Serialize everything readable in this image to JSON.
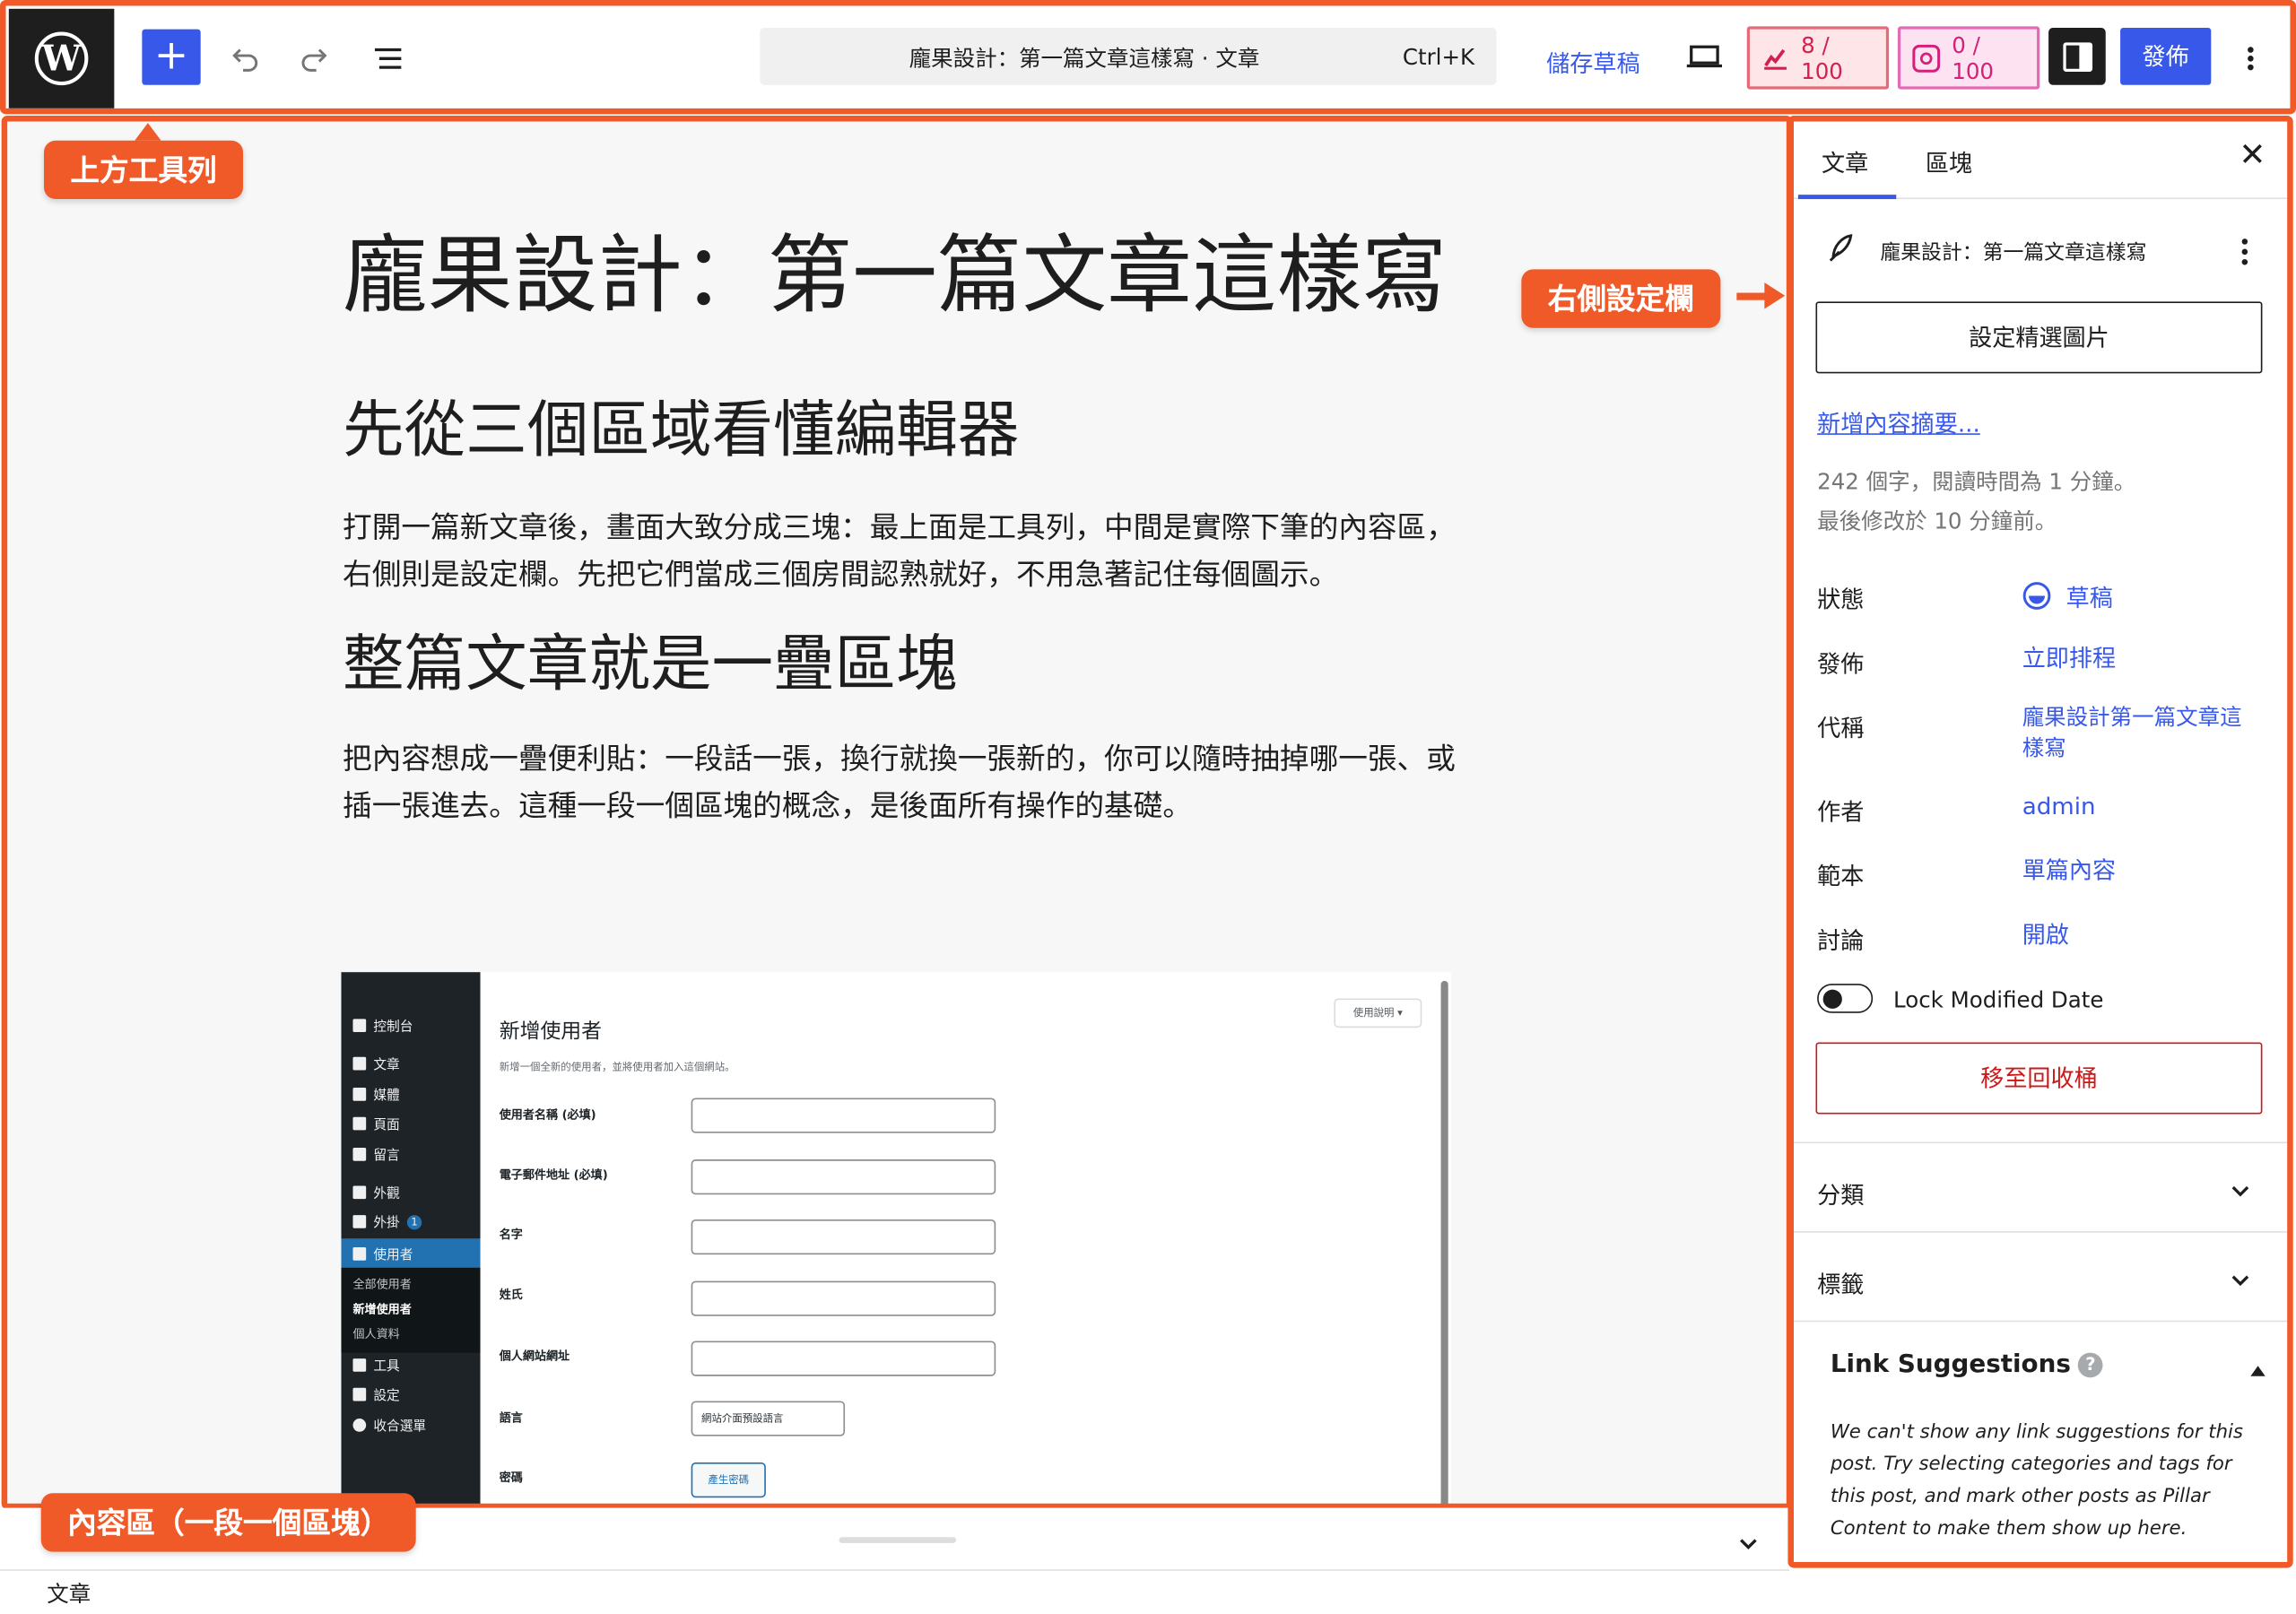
{
  "topbar": {
    "doc_title": "龐果設計：第一篇文章這樣寫 · 文章",
    "shortcut": "Ctrl+K",
    "save_draft": "儲存草稿",
    "counter1": "8 / 100",
    "counter2": "0 / 100",
    "publish": "發佈",
    "accent": "#3858e9"
  },
  "callouts": {
    "top_toolbar": "上方工具列",
    "right_sidebar": "右側設定欄",
    "content_area": "內容區（一段一個區塊）",
    "color": "#f05a28"
  },
  "content": {
    "title": "龐果設計：第一篇文章這樣寫",
    "h2_1": "先從三個區域看懂編輯器",
    "p1": "打開一篇新文章後，畫面大致分成三塊：最上面是工具列，中間是實際下筆的內容區，右側則是設定欄。先把它們當成三個房間認熟就好，不用急著記住每個圖示。",
    "h2_2": "整篇文章就是一疊區塊",
    "p2": "把內容想成一疊便利貼：一段話一張，換行就換一張新的，你可以隨時抽掉哪一張、或插一張進去。這種一段一個區塊的概念，是後面所有操作的基礎。"
  },
  "screenshot": {
    "menu": [
      "控制台",
      "文章",
      "媒體",
      "頁面",
      "留言",
      "外觀",
      "外掛",
      "使用者",
      "工具",
      "設定",
      "收合選單"
    ],
    "plugin_badge": "1",
    "submenu": [
      "全部使用者",
      "新增使用者",
      "個人資料"
    ],
    "heading": "新增使用者",
    "description": "新增一個全新的使用者，並將使用者加入這個網站。",
    "help": "使用說明 ▾",
    "fields": [
      "使用者名稱 (必填)",
      "電子郵件地址 (必填)",
      "名字",
      "姓氏",
      "個人網站網址",
      "語言",
      "密碼"
    ],
    "language_value": "網站介面預設語言",
    "generate_password": "產生密碼"
  },
  "sidebar": {
    "tab_post": "文章",
    "tab_block": "區塊",
    "post_title": "龐果設計：第一篇文章這樣寫",
    "featured_image": "設定精選圖片",
    "add_excerpt": "新增內容摘要...",
    "word_info": "242 個字，閱讀時間為 1 分鐘。",
    "modified": "最後修改於 10 分鐘前。",
    "rows": {
      "status_label": "狀態",
      "status_value": "草稿",
      "publish_label": "發佈",
      "publish_value": "立即排程",
      "slug_label": "代稱",
      "slug_value": "龐果設計第一篇文章這樣寫",
      "author_label": "作者",
      "author_value": "admin",
      "template_label": "範本",
      "template_value": "單篇內容",
      "discussion_label": "討論",
      "discussion_value": "開啟"
    },
    "lock_modified": "Lock Modified Date",
    "trash": "移至回收桶",
    "categories": "分類",
    "tags": "標籤",
    "link_suggestions": "Link Suggestions",
    "link_text": "We can't show any link suggestions for this post. Try selecting categories and tags for this post, and mark other posts as Pillar Content to make them show up here."
  },
  "footer": {
    "breadcrumb": "文章"
  }
}
